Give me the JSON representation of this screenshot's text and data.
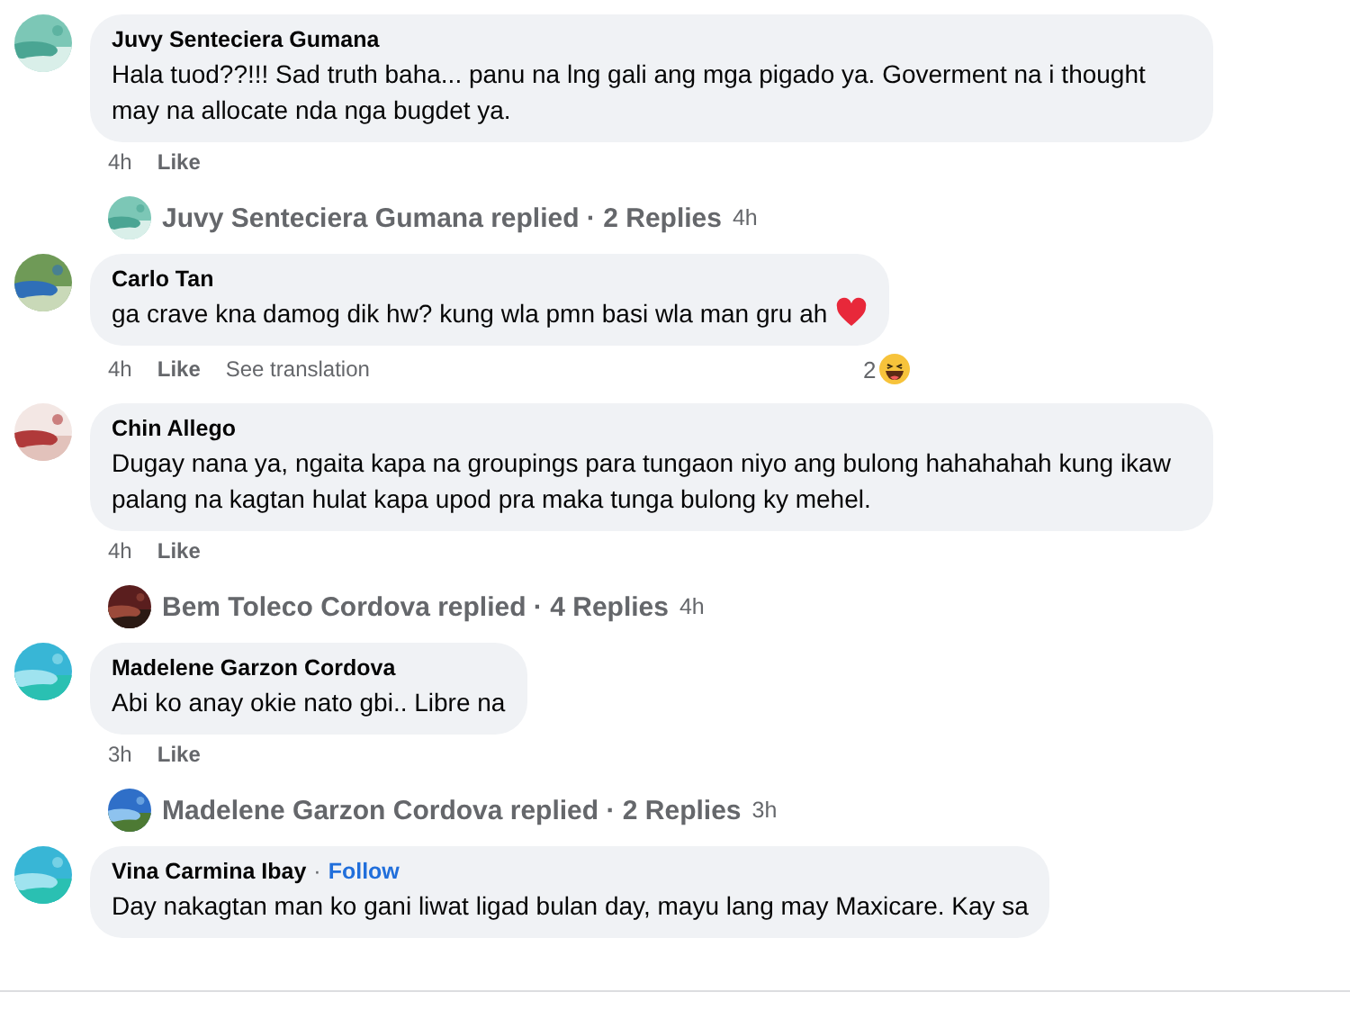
{
  "comments": [
    {
      "author": "Juvy Senteciera Gumana",
      "text": "Hala tuod??!!! Sad truth baha... panu na lng gali ang mga pigado ya. Goverment na i thought may na allocate nda nga bugdet ya.",
      "time": "4h",
      "like": "Like",
      "reply_summary": {
        "text": "Juvy Senteciera Gumana replied · 2 Replies",
        "time": "4h"
      }
    },
    {
      "author": "Carlo Tan",
      "text": "ga crave kna damog dik hw? kung wla pmn basi wla man gru ah",
      "heart_emoji": true,
      "time": "4h",
      "like": "Like",
      "translate": "See translation",
      "reaction_count": "2"
    },
    {
      "author": "Chin Allego",
      "text": "Dugay nana ya, ngaita kapa na groupings para tungaon niyo ang bulong hahahahah kung ikaw palang na kagtan hulat kapa upod pra maka tunga bulong ky mehel.",
      "time": "4h",
      "like": "Like",
      "reply_summary": {
        "text": "Bem Toleco Cordova replied · 4 Replies",
        "time": "4h"
      }
    },
    {
      "author": "Madelene Garzon Cordova",
      "text": "Abi ko anay okie nato gbi.. Libre na",
      "time": "3h",
      "like": "Like",
      "reply_summary": {
        "text": "Madelene Garzon Cordova replied · 2 Replies",
        "time": "3h"
      }
    },
    {
      "author": "Vina Carmina Ibay",
      "follow": {
        "separator": "·",
        "label": "Follow"
      },
      "text": "Day nakagtan man ko gani liwat ligad bulan day, mayu lang may Maxicare. Kay sa"
    }
  ]
}
